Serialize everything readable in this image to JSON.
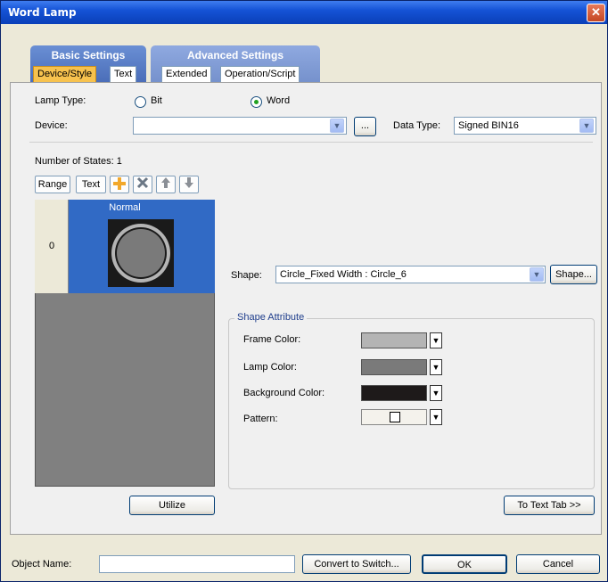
{
  "window": {
    "title": "Word Lamp",
    "close": "✕"
  },
  "tabs": {
    "basic_group": "Basic Settings",
    "advanced_group": "Advanced Settings",
    "device_style": "Device/Style",
    "text": "Text",
    "extended": "Extended",
    "operation_script": "Operation/Script"
  },
  "lamp_type": {
    "label": "Lamp Type:",
    "options": [
      "Bit",
      "Word"
    ],
    "selected": "Word"
  },
  "device": {
    "label": "Device:",
    "value": "",
    "browse": "...",
    "arrow": "▼"
  },
  "data_type": {
    "label": "Data Type:",
    "value": "Signed BIN16"
  },
  "states": {
    "count_label": "Number of States:  1",
    "toolbar": {
      "range": "Range",
      "text": "Text",
      "add_icon": "add-icon",
      "delete_icon": "delete-icon",
      "up_icon": "arrow-up-icon",
      "down_icon": "arrow-down-icon"
    },
    "header": "Normal",
    "rows": [
      {
        "index": "0"
      }
    ]
  },
  "shape": {
    "label": "Shape:",
    "value": "Circle_Fixed Width : Circle_6",
    "button": "Shape..."
  },
  "shape_attribute": {
    "title": "Shape Attribute",
    "frame_color": {
      "label": "Frame Color:",
      "color": "#B4B4B4"
    },
    "lamp_color": {
      "label": "Lamp Color:",
      "color": "#7A7A7A"
    },
    "background_color": {
      "label": "Background Color:",
      "color": "#1E1A1A"
    },
    "pattern": {
      "label": "Pattern:"
    }
  },
  "buttons": {
    "utilize": "Utilize",
    "to_text_tab": "To Text Tab >>",
    "convert": "Convert to Switch...",
    "ok": "OK",
    "cancel": "Cancel"
  },
  "object_name": {
    "label": "Object Name:",
    "value": ""
  }
}
